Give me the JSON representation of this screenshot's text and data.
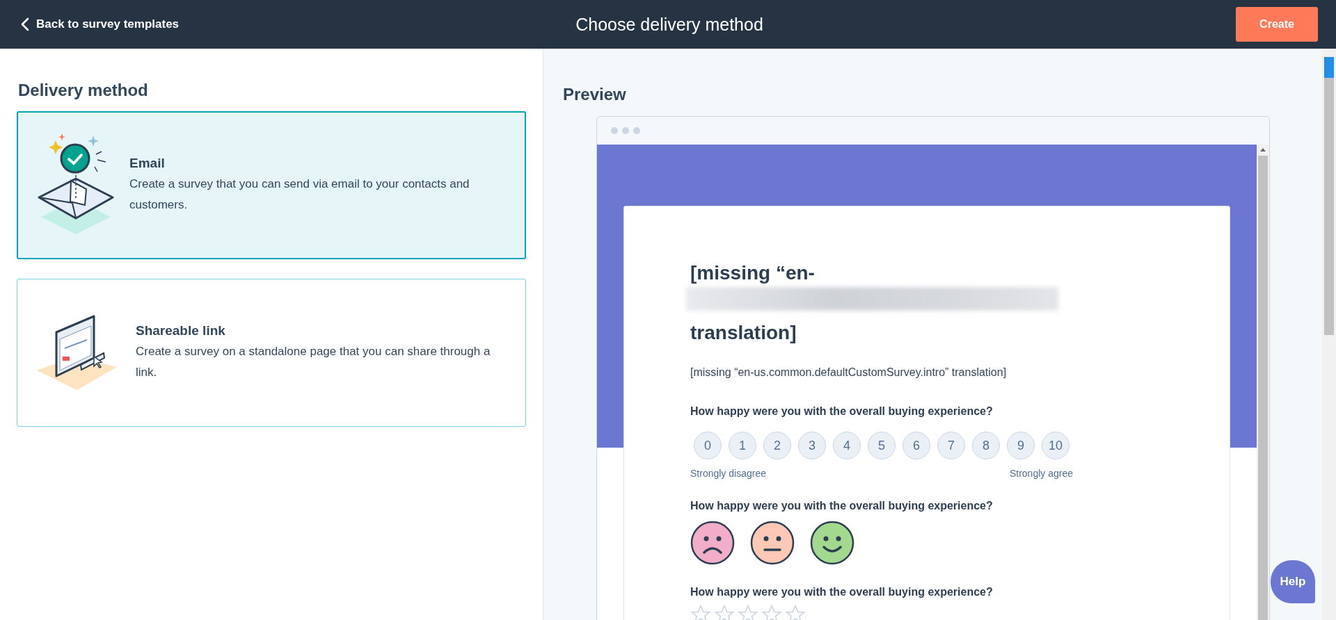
{
  "top_bar": {
    "back_link": "Back to survey templates",
    "title": "Choose delivery method",
    "create_button": "Create"
  },
  "delivery": {
    "heading": "Delivery method",
    "options": [
      {
        "kind": "email",
        "title": "Email",
        "description": "Create a survey that you can send via email to your contacts and customers.",
        "selected": true
      },
      {
        "kind": "link",
        "title": "Shareable link",
        "description": "Create a survey on a standalone page that you can share through a link.",
        "selected": false
      }
    ]
  },
  "preview": {
    "heading": "Preview",
    "survey": {
      "title_start": "[missing “en-",
      "title_end": "translation]",
      "intro": "[missing “en-us.common.defaultCustomSurvey.intro” translation]",
      "questions": [
        {
          "kind": "scale",
          "text": "How happy were you with the overall buying experience?",
          "options": [
            "0",
            "1",
            "2",
            "3",
            "4",
            "5",
            "6",
            "7",
            "8",
            "9",
            "10"
          ],
          "low_label": "Strongly disagree",
          "high_label": "Strongly agree"
        },
        {
          "kind": "faces",
          "text": "How happy were you with the overall buying experience?",
          "faces": [
            {
              "kind": "sad",
              "color": "#f2aec9"
            },
            {
              "kind": "neutral",
              "color": "#fdc9b6"
            },
            {
              "kind": "happy",
              "color": "#a3d98f"
            }
          ]
        },
        {
          "kind": "stars",
          "text": "How happy were you with the overall buying experience?",
          "stars": 0
        }
      ]
    }
  },
  "help_button": "Help"
}
